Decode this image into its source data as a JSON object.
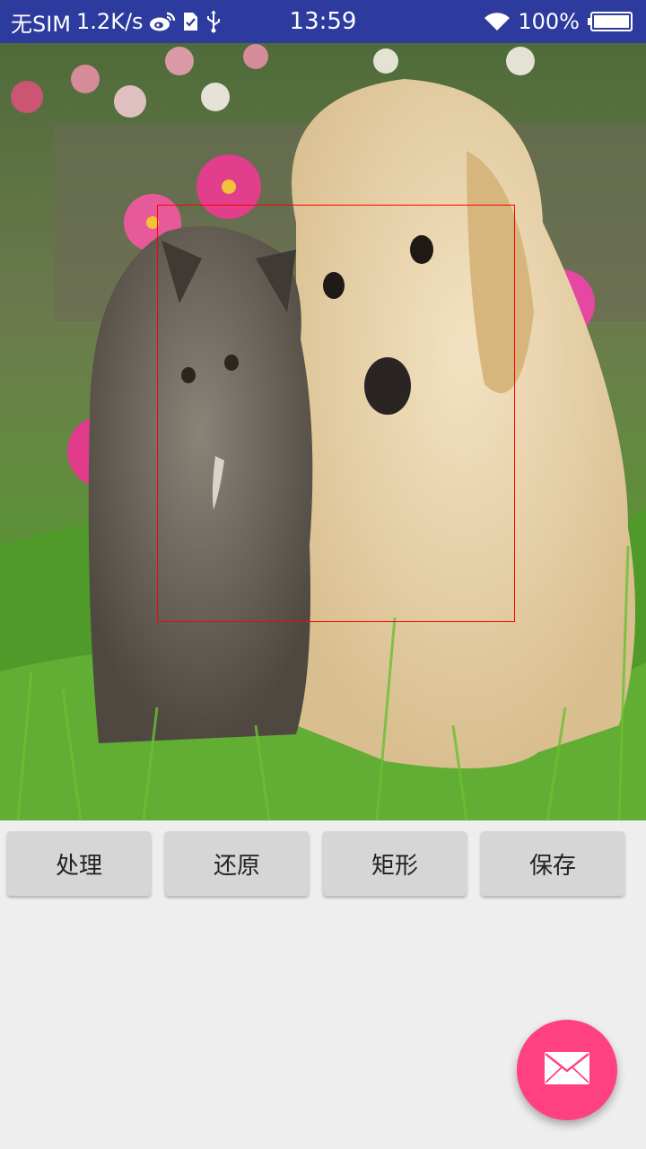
{
  "status_bar": {
    "carrier": "无SIM",
    "speed": "1.2K/s",
    "time": "13:59",
    "battery": "100%",
    "icons": [
      "weibo-icon",
      "sim-card-icon",
      "usb-icon",
      "wifi-icon",
      "battery-icon"
    ]
  },
  "image": {
    "subject": "puppy-and-kitten-photo"
  },
  "buttons": {
    "process": "处理",
    "restore": "还原",
    "rect": "矩形",
    "save": "保存"
  },
  "fab": {
    "icon": "mail-icon",
    "color": "#ff4081"
  },
  "colors": {
    "status_bar": "#2d3a9e",
    "roi_border": "#ff0000",
    "background": "#eeeeee",
    "button": "#d6d6d6"
  }
}
